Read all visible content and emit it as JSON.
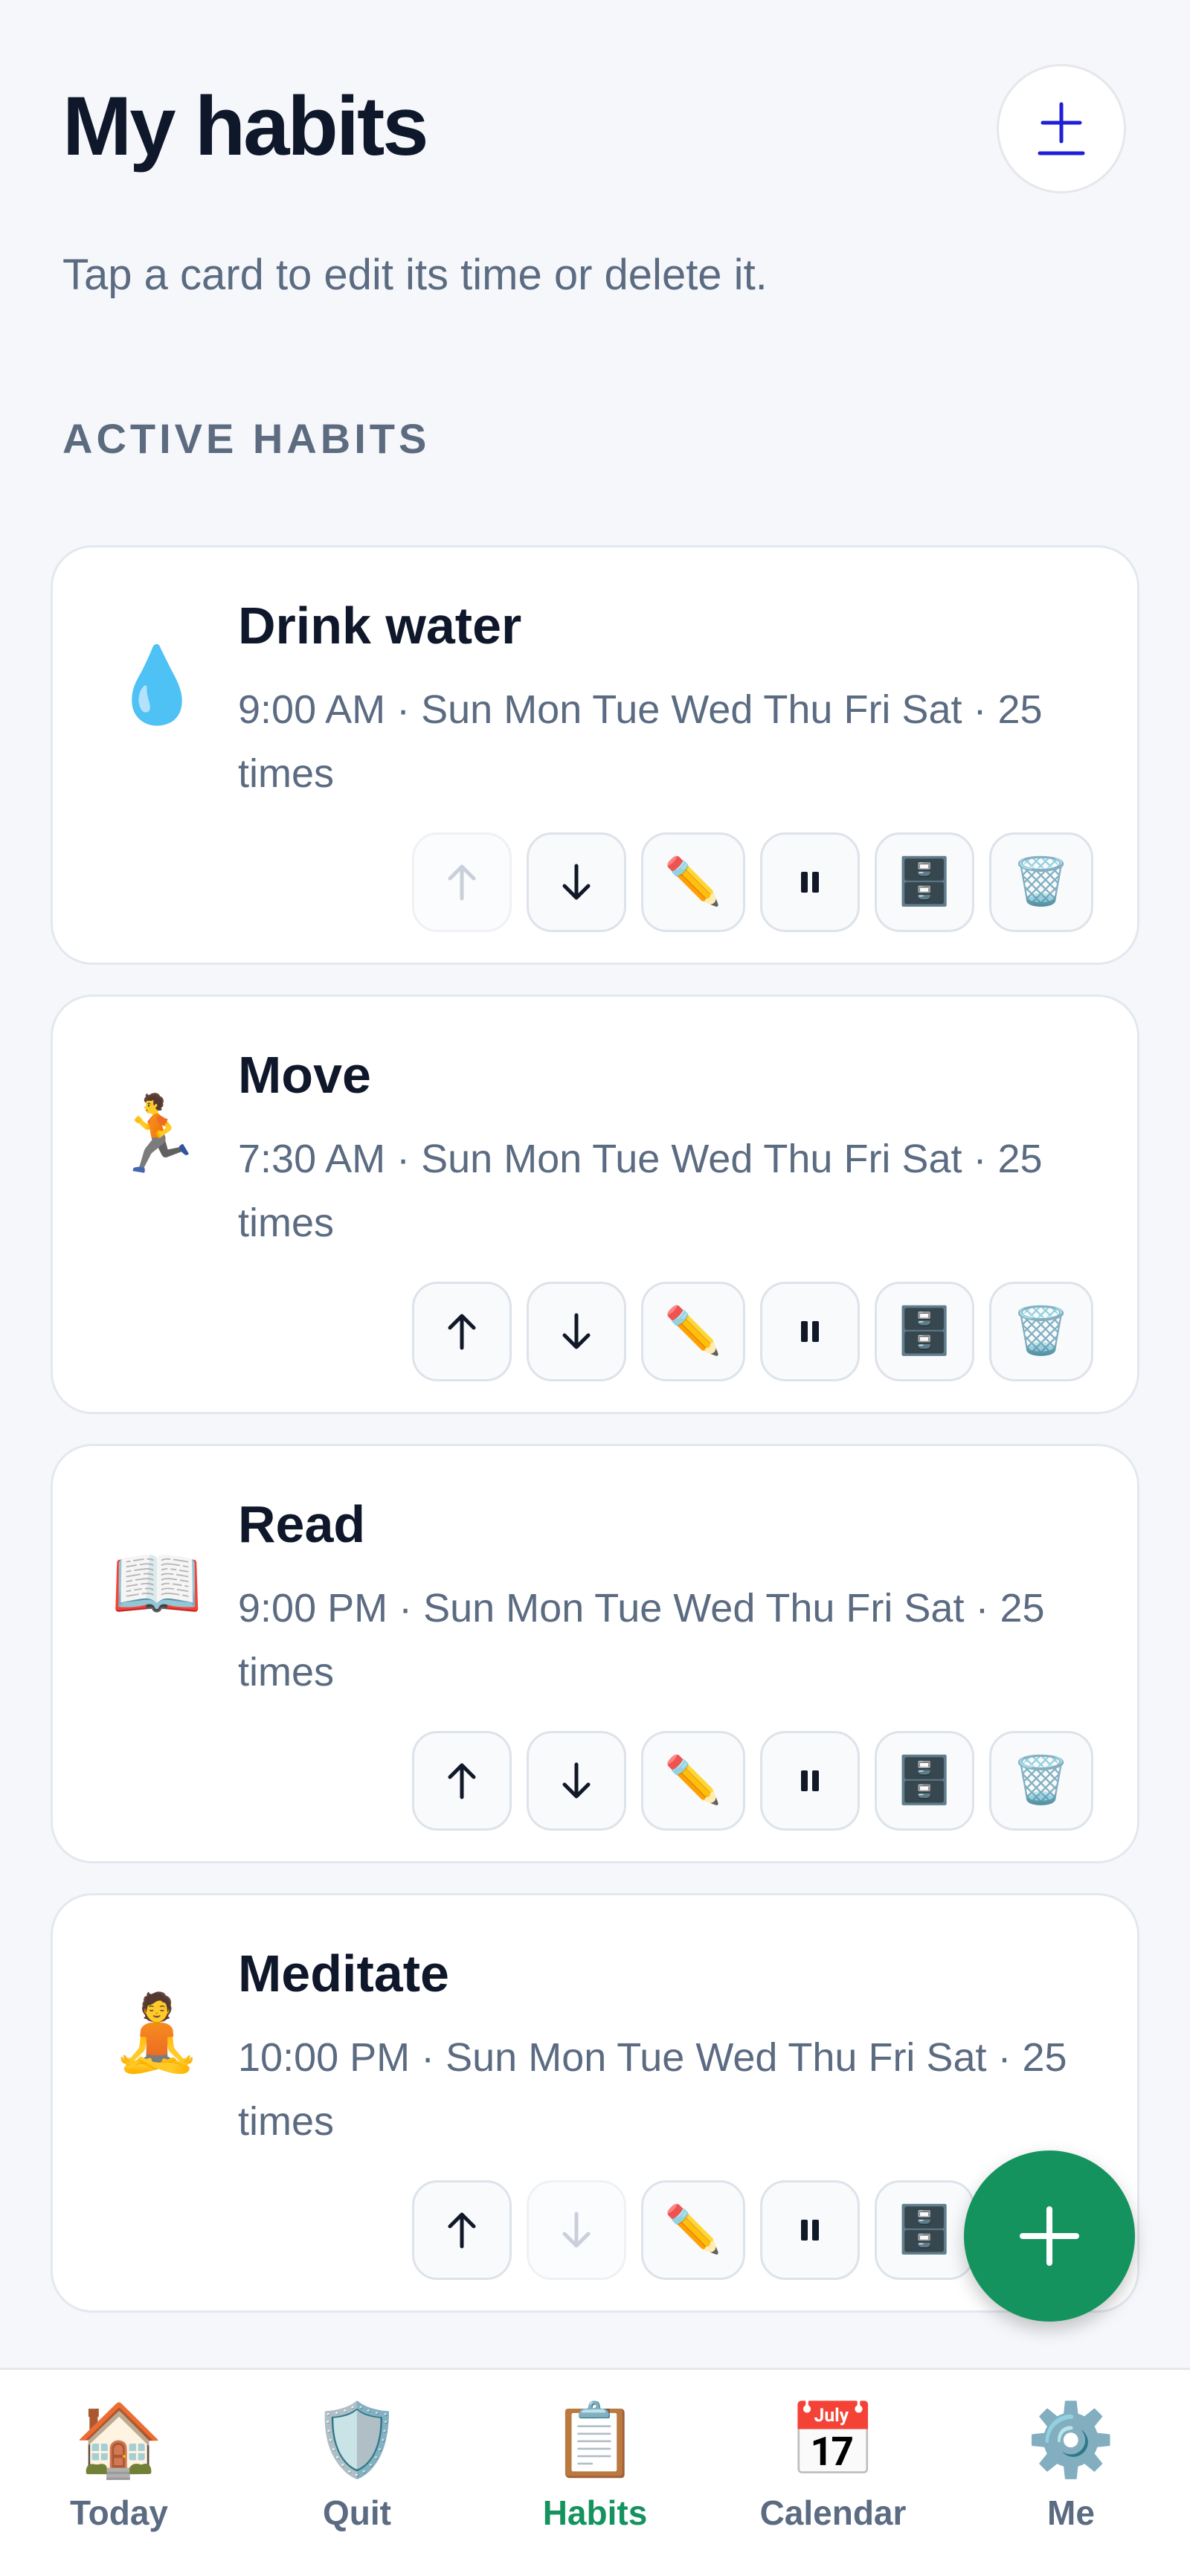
{
  "header": {
    "title": "My habits",
    "subtitle": "Tap a card to edit its time or delete it.",
    "add_icon": "plus-icon"
  },
  "section_title": "ACTIVE HABITS",
  "habits": [
    {
      "name": "Drink water",
      "emoji": "💧",
      "meta": "9:00 AM · Sun Mon Tue Wed Thu Fri Sat · 25 times",
      "actions": [
        "up-arrow-disabled",
        "down-arrow",
        "pencil",
        "pause",
        "archive",
        "trash"
      ]
    },
    {
      "name": "Move",
      "emoji": "🏃",
      "meta": "7:30 AM · Sun Mon Tue Wed Thu Fri Sat · 25 times",
      "actions": [
        "up-arrow",
        "down-arrow",
        "pencil",
        "pause",
        "archive",
        "trash"
      ]
    },
    {
      "name": "Read",
      "emoji": "📖",
      "meta": "9:00 PM · Sun Mon Tue Wed Thu Fri Sat · 25 times",
      "actions": [
        "up-arrow",
        "down-arrow",
        "pencil",
        "pause",
        "archive",
        "trash"
      ]
    },
    {
      "name": "Meditate",
      "emoji": "🧘",
      "meta": "10:00 PM · Sun Mon Tue Wed Thu Fri Sat · 25 times",
      "actions": [
        "up-arrow",
        "down-arrow-disabled",
        "pencil",
        "pause",
        "archive"
      ]
    }
  ],
  "fab": {
    "icon": "plus-icon"
  },
  "nav": {
    "items": [
      {
        "label": "Today",
        "icon": "🏠"
      },
      {
        "label": "Quit",
        "icon": "🛡️"
      },
      {
        "label": "Habits",
        "icon": "📋"
      },
      {
        "label": "Calendar",
        "icon": "📅"
      },
      {
        "label": "Me",
        "icon": "⚙️"
      }
    ],
    "active": "Habits"
  },
  "colors": {
    "accent": "#14935f",
    "text_primary": "#0f172a",
    "text_secondary": "#5b6b82",
    "background": "#f5f7fa",
    "add_icon": "#1e1fd6"
  }
}
